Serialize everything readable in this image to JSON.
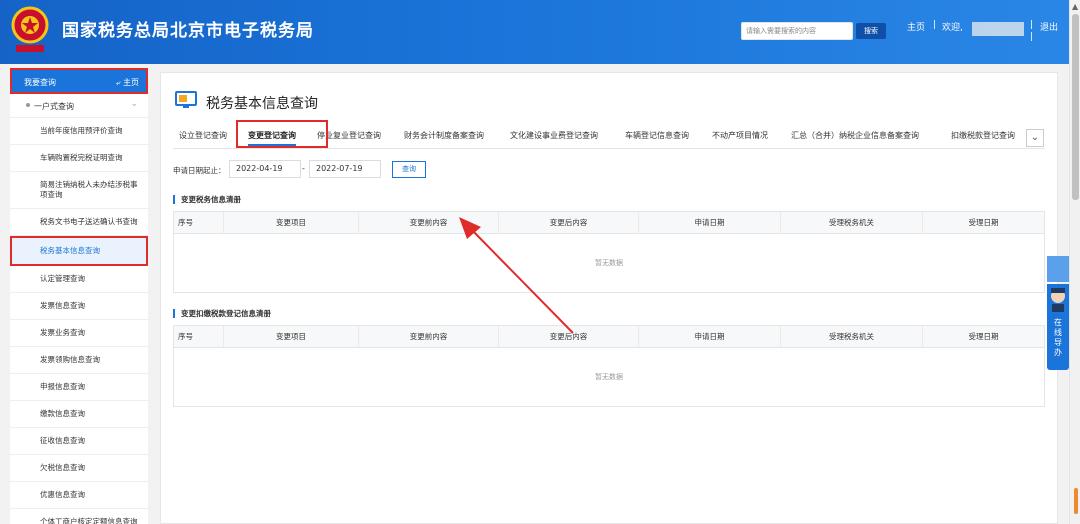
{
  "header": {
    "title": "国家税务总局北京市电子税务局",
    "search_placeholder": "请输入需要搜索的内容",
    "search_label": "搜索",
    "home_link": "主页",
    "welcome": "欢迎,",
    "logout": "退出",
    "sep": "|"
  },
  "sidebar": {
    "top_label": "我要查询",
    "home_label": "主页",
    "group_label": "一户式查询",
    "items": [
      {
        "label": "当前年度信用预评价查询"
      },
      {
        "label": "车辆购置税完税证明查询"
      },
      {
        "label": "简易注销纳税人未办结涉税事项查询"
      },
      {
        "label": "税务文书电子送达确认书查询"
      },
      {
        "label": "税务基本信息查询"
      },
      {
        "label": "认定管理查询"
      },
      {
        "label": "发票信息查询"
      },
      {
        "label": "发票业务查询"
      },
      {
        "label": "发票领购信息查询"
      },
      {
        "label": "申报信息查询"
      },
      {
        "label": "缴款信息查询"
      },
      {
        "label": "征收信息查询"
      },
      {
        "label": "欠税信息查询"
      },
      {
        "label": "优惠信息查询"
      },
      {
        "label": "个体工商户核定定额信息查询"
      }
    ]
  },
  "main": {
    "page_title": "税务基本信息查询",
    "tabs": [
      {
        "label": "设立登记查询"
      },
      {
        "label": "变更登记查询"
      },
      {
        "label": "停业复业登记查询"
      },
      {
        "label": "财务会计制度备案查询"
      },
      {
        "label": "文化建设事业费登记查询"
      },
      {
        "label": "车辆登记信息查询"
      },
      {
        "label": "不动产项目情况"
      },
      {
        "label": "汇总（合并）纳税企业信息备案查询"
      },
      {
        "label": "扣缴税款登记查询"
      }
    ],
    "date_label": "申请日期起止：",
    "date_start": "2022-04-19",
    "date_dash": "-",
    "date_end": "2022-07-19",
    "query_label": "查询",
    "section1_title": "变更税务信息清册",
    "section2_title": "变更扣缴税款登记信息清册",
    "columns": [
      "序号",
      "变更项目",
      "变更前内容",
      "变更后内容",
      "申请日期",
      "受理税务机关",
      "受理日期"
    ],
    "no_data": "暂无数据"
  },
  "float_widget": {
    "label_chars": [
      "在",
      "线",
      "导",
      "办"
    ]
  },
  "colors": {
    "brand_blue": "#1a74d9",
    "highlight_red": "#e02b2b"
  }
}
